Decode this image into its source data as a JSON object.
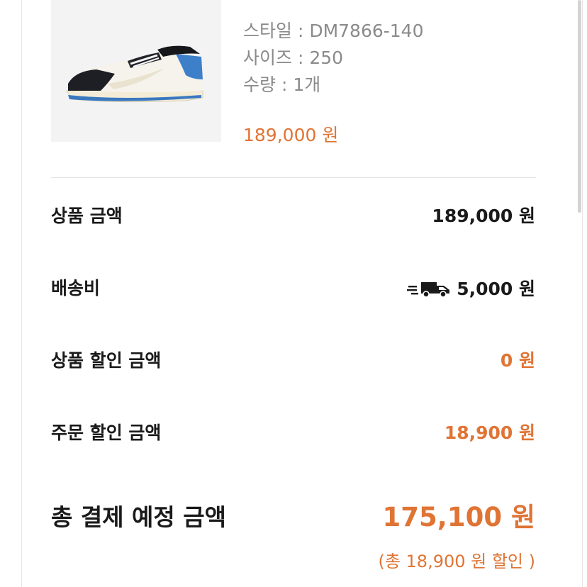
{
  "product": {
    "image_alt": "sneaker",
    "style": "스타일 : DM7866-140",
    "size": "사이즈 : 250",
    "quantity": "수량 : 1개",
    "price": "189,000 원"
  },
  "summary": {
    "product_amount_label": "상품 금액",
    "product_amount_value": "189,000 원",
    "shipping_label": "배송비",
    "shipping_icon": "delivery-truck-icon",
    "shipping_value": "5,000 원",
    "product_discount_label": "상품 할인 금액",
    "product_discount_value": "0 원",
    "order_discount_label": "주문 할인 금액",
    "order_discount_value": "18,900 원"
  },
  "total": {
    "label": "총 결제 예정 금액",
    "value": "175,100 원",
    "note": "(총 18,900 원 할인 )"
  },
  "colors": {
    "accent": "#e07434",
    "text": "#1a1a1a",
    "muted": "#8a8a8a"
  }
}
